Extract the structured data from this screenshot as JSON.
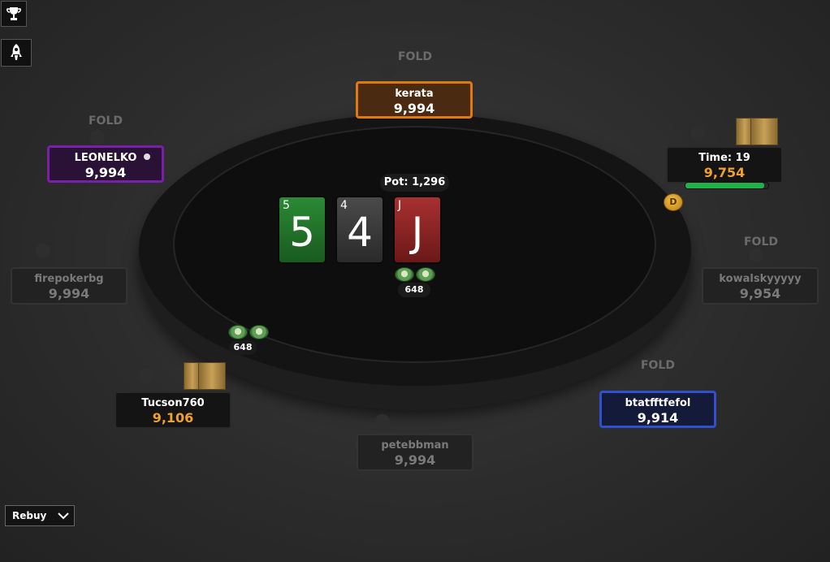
{
  "pot": {
    "label": "Pot: 1,296"
  },
  "board": [
    {
      "rank": "5",
      "color": "#1f7a2a"
    },
    {
      "rank": "4",
      "color": "#3a3a3a"
    },
    {
      "rank": "J",
      "color": "#8a1f1f"
    }
  ],
  "seats": {
    "kerata": {
      "name": "kerata",
      "stack": "9,994",
      "border": "#e07a10",
      "status": "FOLD"
    },
    "leonelko": {
      "name": "LEONELKO",
      "stack": "9,994",
      "border": "#7a1fa8",
      "status": "FOLD"
    },
    "hero": {
      "name": "Time: 19",
      "stack": "9,754",
      "timer_fraction": 0.95
    },
    "firepokerbg": {
      "name": "firepokerbg",
      "stack": "9,994"
    },
    "kowalskyyyyy": {
      "name": "kowalskyyyyy",
      "stack": "9,954",
      "status": "FOLD"
    },
    "tucson760": {
      "name": "Tucson760",
      "stack": "9,106"
    },
    "btatfftfefol": {
      "name": "btatfftfefol",
      "stack": "9,914",
      "border": "#3050d0",
      "status": "FOLD"
    },
    "petebbman": {
      "name": "petebbman",
      "stack": "9,994"
    }
  },
  "bets": {
    "center": {
      "amount": "648"
    },
    "left": {
      "amount": "648"
    }
  },
  "dealer_button": {
    "label": "D"
  },
  "rebuy": {
    "label": "Rebuy",
    "icon": "chevron-down-icon"
  },
  "corner": {
    "top_icon": "trophy-icon",
    "bottom_icon": "rocket-icon"
  },
  "colors": {
    "stack_highlight": "#f0a030"
  }
}
